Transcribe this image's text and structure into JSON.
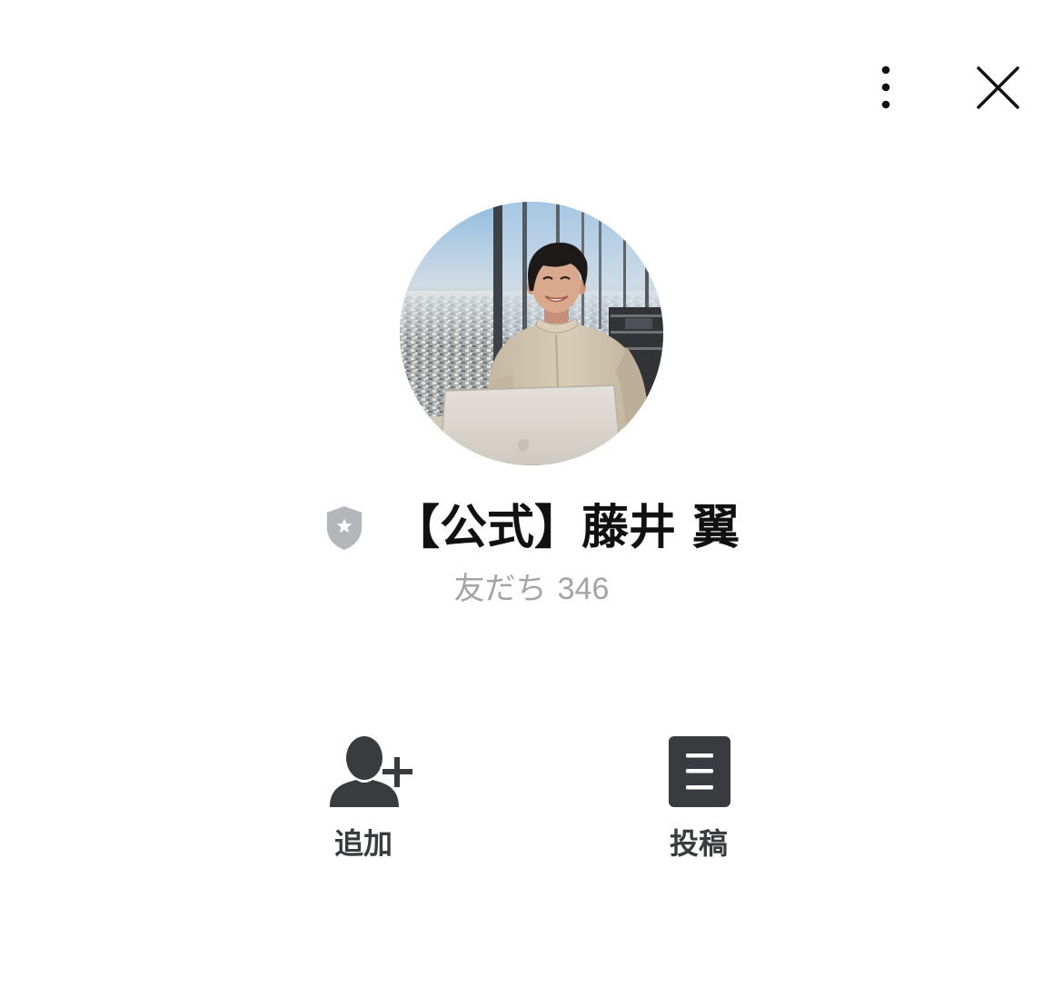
{
  "header": {
    "more_icon": "more-vertical-icon",
    "close_icon": "close-icon"
  },
  "profile": {
    "badge_icon": "official-account-shield-icon",
    "name": "【公式】藤井 翼",
    "friends_label": "友だち",
    "friends_count": "346"
  },
  "actions": [
    {
      "label": "追加",
      "icon": "add-friend-icon"
    },
    {
      "label": "投稿",
      "icon": "posts-icon"
    }
  ],
  "colors": {
    "background": "#ffffff",
    "name_text": "#111111",
    "friends_text": "#a4a4a4",
    "icon_dark": "#3a3b3f",
    "badge_gray": "#b5b6b9"
  }
}
